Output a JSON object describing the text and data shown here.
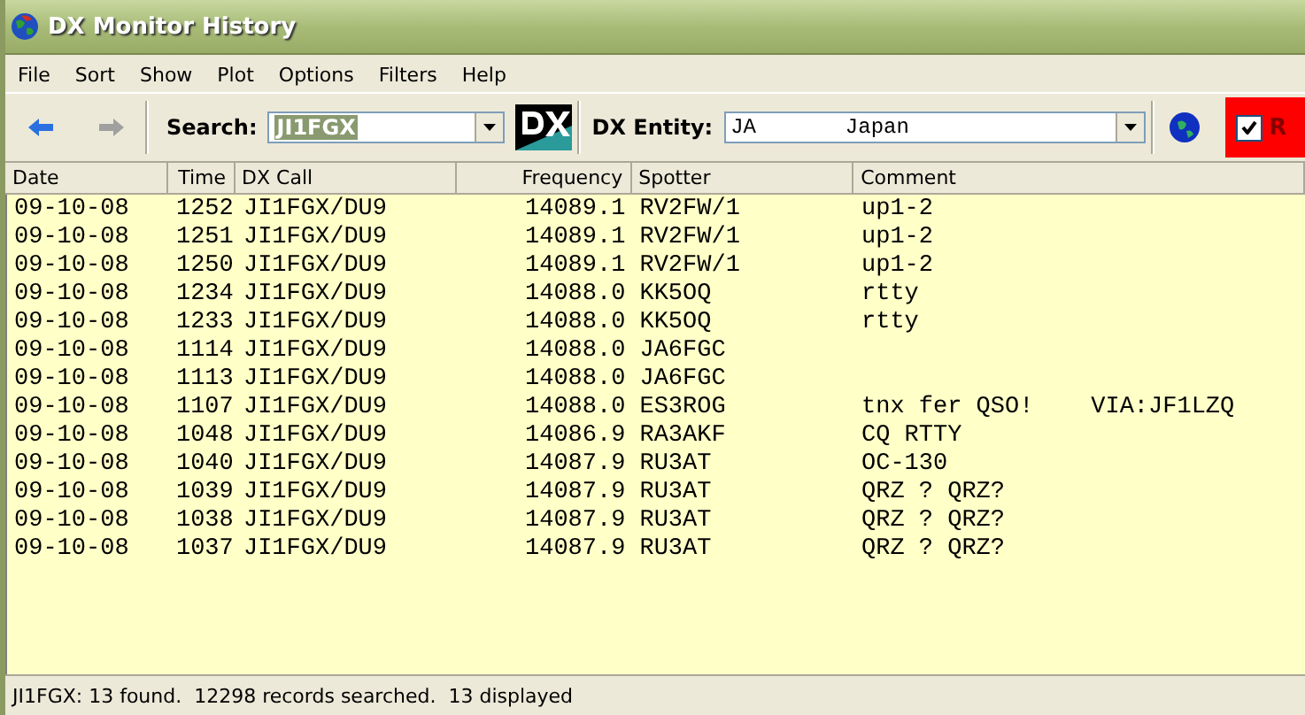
{
  "window": {
    "title": "DX Monitor History"
  },
  "menu": [
    "File",
    "Sort",
    "Show",
    "Plot",
    "Options",
    "Filters",
    "Help"
  ],
  "toolbar": {
    "search_label": "Search:",
    "search_value": "JI1FGX",
    "entity_label": "DX Entity:",
    "entity_value": "JA       Japan",
    "filter": {
      "label": "R",
      "checked": true
    }
  },
  "table": {
    "columns": [
      "Date",
      "Time",
      "DX Call",
      "Frequency",
      "Spotter",
      "Comment"
    ],
    "rows": [
      [
        "09-10-08",
        "1252",
        "JI1FGX/DU9",
        "14089.1",
        "RV2FW/1",
        "up1-2"
      ],
      [
        "09-10-08",
        "1251",
        "JI1FGX/DU9",
        "14089.1",
        "RV2FW/1",
        "up1-2"
      ],
      [
        "09-10-08",
        "1250",
        "JI1FGX/DU9",
        "14089.1",
        "RV2FW/1",
        "up1-2"
      ],
      [
        "09-10-08",
        "1234",
        "JI1FGX/DU9",
        "14088.0",
        "KK5OQ",
        "rtty"
      ],
      [
        "09-10-08",
        "1233",
        "JI1FGX/DU9",
        "14088.0",
        "KK5OQ",
        "rtty"
      ],
      [
        "09-10-08",
        "1114",
        "JI1FGX/DU9",
        "14088.0",
        "JA6FGC",
        ""
      ],
      [
        "09-10-08",
        "1113",
        "JI1FGX/DU9",
        "14088.0",
        "JA6FGC",
        ""
      ],
      [
        "09-10-08",
        "1107",
        "JI1FGX/DU9",
        "14088.0",
        "ES3ROG",
        "tnx fer QSO!    VIA:JF1LZQ"
      ],
      [
        "09-10-08",
        "1048",
        "JI1FGX/DU9",
        "14086.9",
        "RA3AKF",
        "CQ RTTY"
      ],
      [
        "09-10-08",
        "1040",
        "JI1FGX/DU9",
        "14087.9",
        "RU3AT",
        "OC-130"
      ],
      [
        "09-10-08",
        "1039",
        "JI1FGX/DU9",
        "14087.9",
        "RU3AT",
        "QRZ ? QRZ?"
      ],
      [
        "09-10-08",
        "1038",
        "JI1FGX/DU9",
        "14087.9",
        "RU3AT",
        "QRZ ? QRZ?"
      ],
      [
        "09-10-08",
        "1037",
        "JI1FGX/DU9",
        "14087.9",
        "RU3AT",
        "QRZ ? QRZ?"
      ]
    ]
  },
  "status_bar": "JI1FGX: 13 found.  12298 records searched.  13 displayed"
}
